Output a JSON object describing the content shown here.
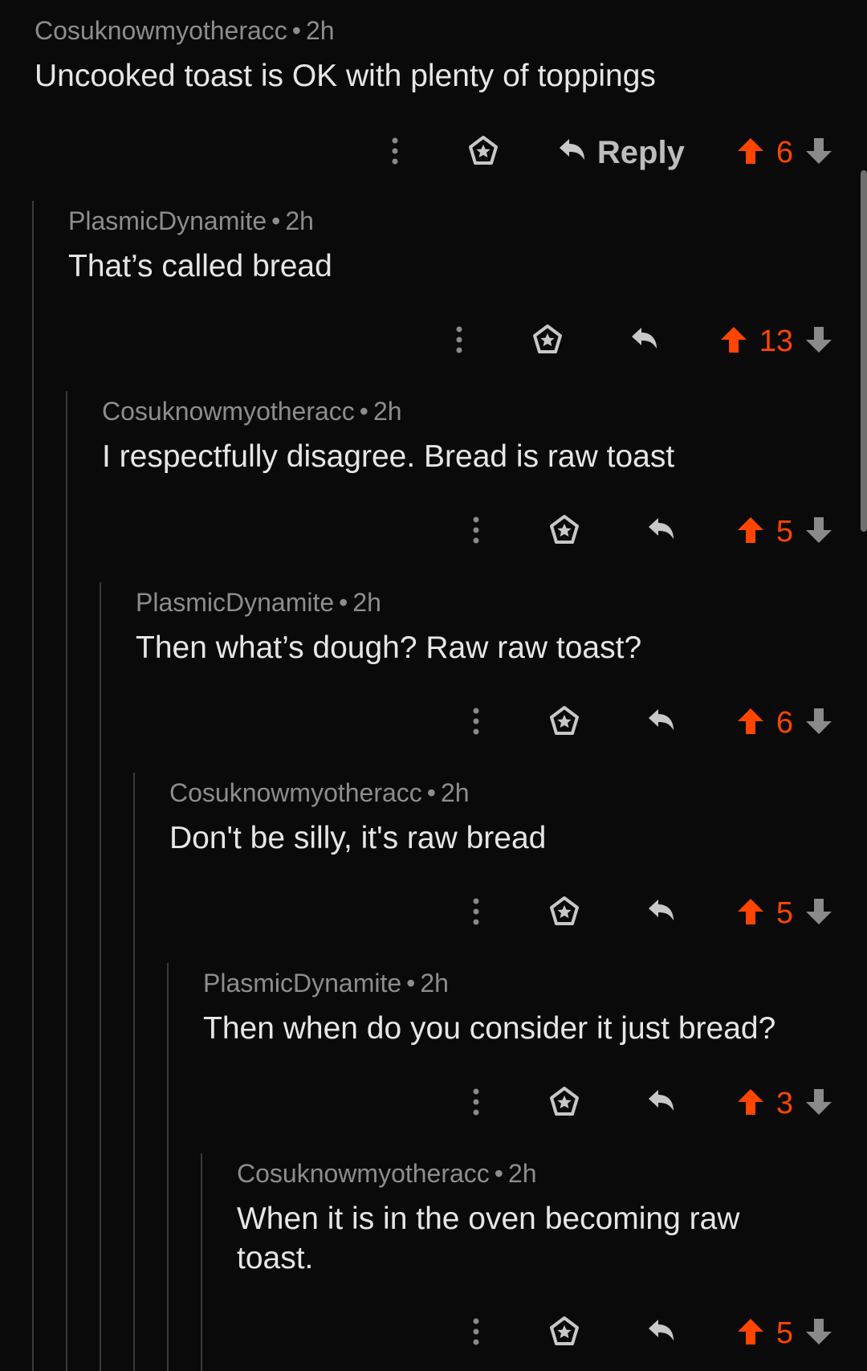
{
  "colors": {
    "background": "#0a0a0a",
    "upvote": "#ff4500",
    "meta": "#8d8d8d",
    "text": "#e6e6e6"
  },
  "separator": "•",
  "comments": [
    {
      "author": "Cosuknowmyotheracc",
      "time": "2h",
      "body": "Uncooked toast is OK with plenty of toppings",
      "score": "6",
      "reply_label": "Reply",
      "upvoted": true
    },
    {
      "author": "PlasmicDynamite",
      "time": "2h",
      "body": "That’s called bread",
      "score": "13",
      "upvoted": true
    },
    {
      "author": "Cosuknowmyotheracc",
      "time": "2h",
      "body": "I respectfully disagree. Bread is raw toast",
      "score": "5",
      "upvoted": true
    },
    {
      "author": "PlasmicDynamite",
      "time": "2h",
      "body": "Then what’s dough? Raw raw toast?",
      "score": "6",
      "upvoted": true
    },
    {
      "author": "Cosuknowmyotheracc",
      "time": "2h",
      "body": "Don't be silly, it's raw bread",
      "score": "5",
      "upvoted": true
    },
    {
      "author": "PlasmicDynamite",
      "time": "2h",
      "body": "Then when do you consider it just bread?",
      "score": "3",
      "upvoted": true
    },
    {
      "author": "Cosuknowmyotheracc",
      "time": "2h",
      "body": "When it is in the oven becoming raw toast.",
      "score": "5",
      "upvoted": true
    }
  ],
  "icons": {
    "more": "more-vertical-icon",
    "award": "award-icon",
    "reply": "reply-arrow-icon",
    "upvote": "upvote-arrow-icon",
    "downvote": "downvote-arrow-icon"
  }
}
